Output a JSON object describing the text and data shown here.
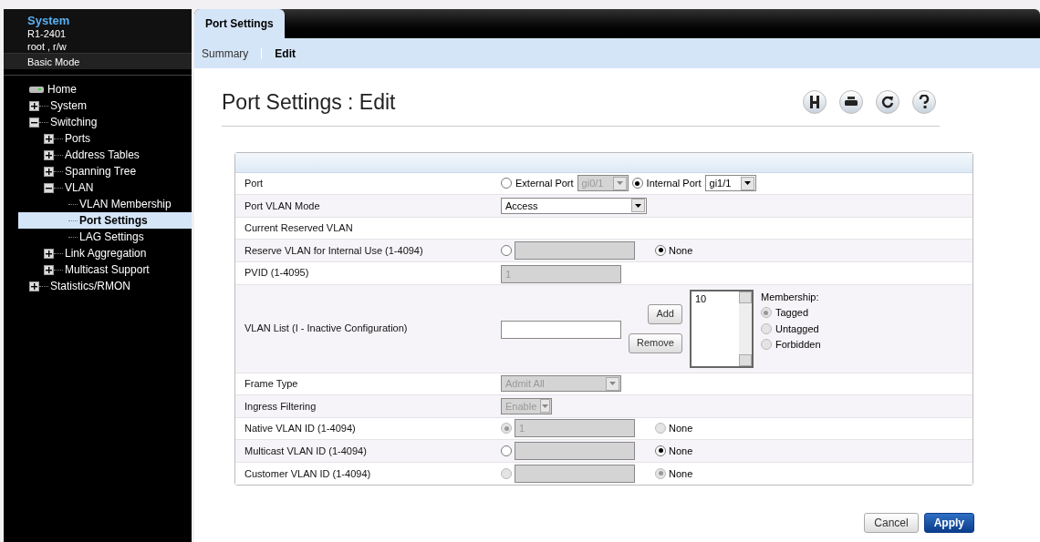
{
  "sidebar": {
    "title": "System",
    "device": "R1-2401",
    "user": "root , r/w",
    "mode": "Basic Mode",
    "tree": [
      {
        "label": "Home",
        "selected": false,
        "children": [
          {
            "label": "System",
            "expanded": false,
            "selected": false
          },
          {
            "label": "Switching",
            "expanded": true,
            "selected": false,
            "children": [
              {
                "label": "Ports",
                "expanded": false,
                "selected": false
              },
              {
                "label": "Address Tables",
                "expanded": false,
                "selected": false
              },
              {
                "label": "Spanning Tree",
                "expanded": false,
                "selected": false
              },
              {
                "label": "VLAN",
                "expanded": true,
                "selected": false,
                "children": [
                  {
                    "label": "VLAN Membership",
                    "selected": false
                  },
                  {
                    "label": "Port Settings",
                    "selected": true
                  },
                  {
                    "label": "LAG Settings",
                    "selected": false
                  }
                ]
              },
              {
                "label": "Link Aggregation",
                "expanded": false,
                "selected": false
              },
              {
                "label": "Multicast Support",
                "expanded": false,
                "selected": false
              }
            ]
          },
          {
            "label": "Statistics/RMON",
            "expanded": false,
            "selected": false
          }
        ]
      }
    ]
  },
  "tabs": [
    {
      "label": "Port Settings",
      "selected": true
    }
  ],
  "subnav": [
    {
      "label": "Summary",
      "selected": false
    },
    {
      "label": "Edit",
      "selected": true
    }
  ],
  "page_title": "Port Settings : Edit",
  "form": {
    "rows": [
      {
        "label": "Port",
        "kind": "port",
        "options": [
          {
            "label": "External Port",
            "selected": false,
            "select": "gi0/1",
            "disabled": true
          },
          {
            "label": "Internal Port",
            "selected": true,
            "select": "gi1/1",
            "disabled": false
          }
        ]
      },
      {
        "label": "Port VLAN Mode",
        "kind": "wide_select",
        "value": "Access",
        "disabled": false
      },
      {
        "label": "Current Reserved VLAN",
        "kind": "label"
      },
      {
        "label": "Reserve VLAN for Internal Use (1-4094)",
        "kind": "choice",
        "custom_selected": false,
        "custom_disabled": false,
        "none_label": "None",
        "none_selected": true,
        "none_disabled": false
      },
      {
        "label": "PVID (1-4095)",
        "kind": "field",
        "value": "1",
        "disabled": true
      },
      {
        "label": "VLAN List (I - Inactive Configuration)",
        "kind": "vlan_list",
        "buttons": [
          "Add",
          "Remove"
        ],
        "items": [
          "10"
        ],
        "membership_label": "Membership:",
        "membership": [
          {
            "label": "Tagged",
            "selected": true
          },
          {
            "label": "Untagged",
            "selected": false
          },
          {
            "label": "Forbidden",
            "selected": false
          }
        ],
        "membership_disabled": true
      },
      {
        "label": "Frame Type",
        "kind": "select",
        "value": "Admit All",
        "disabled": true
      },
      {
        "label": "Ingress Filtering",
        "kind": "short_select",
        "value": "Enable",
        "disabled": true
      },
      {
        "label": "Native VLAN ID (1-4094)",
        "kind": "choice",
        "value": "1",
        "custom_selected": true,
        "custom_disabled": true,
        "none_label": "None",
        "none_selected": false,
        "none_disabled": true
      },
      {
        "label": "Multicast VLAN ID (1-4094)",
        "kind": "choice",
        "custom_selected": false,
        "custom_disabled": false,
        "none_label": "None",
        "none_selected": true,
        "none_disabled": false
      },
      {
        "label": "Customer VLAN ID (1-4094)",
        "kind": "choice",
        "custom_selected": false,
        "custom_disabled": true,
        "none_label": "None",
        "none_selected": true,
        "none_disabled": true
      }
    ]
  },
  "buttons": [
    {
      "label": "Cancel",
      "kind": "secondary"
    },
    {
      "label": "Apply",
      "kind": "primary"
    }
  ]
}
